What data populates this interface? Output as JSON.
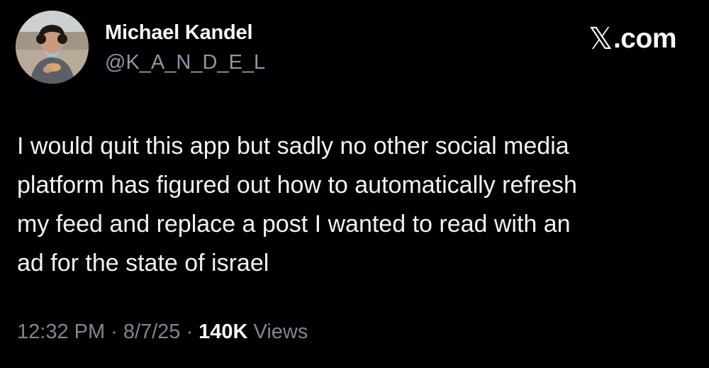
{
  "author": {
    "display_name": "Michael Kandel",
    "handle": "@K_A_N_D_E_L",
    "avatar_icon": "profile-photo"
  },
  "brand": {
    "label": ".com",
    "icon": "x-logo-icon"
  },
  "tweet": {
    "text": "I would quit this app but sadly no other social media\nplatform has figured out how to automatically refresh\nmy feed and replace a post I wanted to read with an\nad for the state of israel"
  },
  "meta": {
    "time": "12:32 PM",
    "separator": "·",
    "date": "8/7/25",
    "views_count": "140K",
    "views_label": "Views"
  },
  "colors": {
    "background": "#000000",
    "primary_text": "#e7e9ea",
    "secondary_text": "#7d8891"
  }
}
